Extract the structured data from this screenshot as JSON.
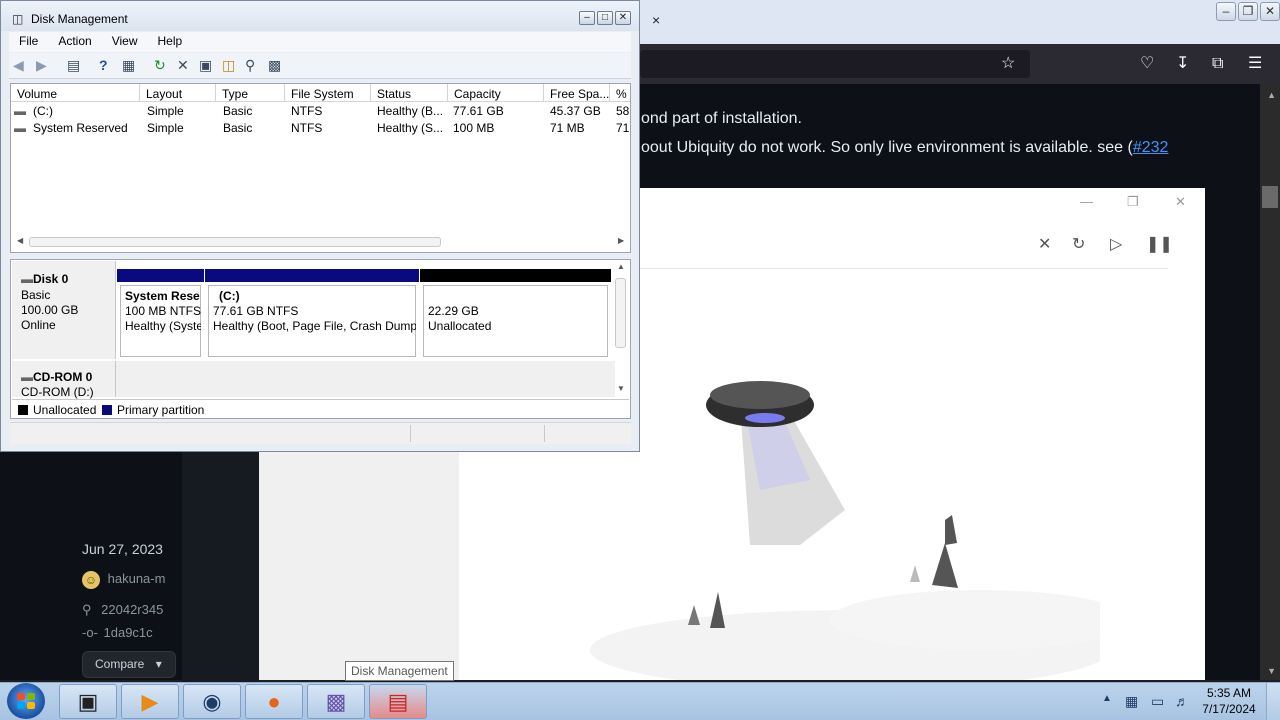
{
  "browser": {
    "text_line1": "ond part of installation.",
    "text_line2": "oout Ubiquity do not work. So only live environment is available. see (",
    "link": "#232",
    "date": "Jun 27, 2023",
    "author": "hakuna-m",
    "tag": "22042r345",
    "commit": "1da9c1c",
    "compare_label": "Compare",
    "close_glyph": "×"
  },
  "disk_management": {
    "title": "Disk Management",
    "menu": [
      "File",
      "Action",
      "View",
      "Help"
    ],
    "columns": [
      "Volume",
      "Layout",
      "Type",
      "File System",
      "Status",
      "Capacity",
      "Free Spa...",
      "%"
    ],
    "volumes": [
      {
        "volume": "(C:)",
        "layout": "Simple",
        "type": "Basic",
        "fs": "NTFS",
        "status": "Healthy (B...",
        "capacity": "77.61 GB",
        "free": "45.37 GB",
        "pct": "58"
      },
      {
        "volume": "System Reserved",
        "layout": "Simple",
        "type": "Basic",
        "fs": "NTFS",
        "status": "Healthy (S...",
        "capacity": "100 MB",
        "free": "71 MB",
        "pct": "71"
      }
    ],
    "disk0": {
      "name": "Disk 0",
      "type": "Basic",
      "size": "100.00 GB",
      "state": "Online",
      "partitions": [
        {
          "name": "System Rese",
          "size": "100 MB NTFS",
          "status": "Healthy (Syste"
        },
        {
          "name": "(C:)",
          "size": "77.61 GB NTFS",
          "status": "Healthy (Boot, Page File, Crash Dump,"
        },
        {
          "name": "",
          "size": "22.29 GB",
          "status": "Unallocated"
        }
      ]
    },
    "cdrom": {
      "name": "CD-ROM 0",
      "drive": "CD-ROM (D:)"
    },
    "legend": {
      "unallocated": "Unallocated",
      "primary": "Primary partition"
    },
    "colors": {
      "primary": "#0a0a80",
      "unallocated": "#000000"
    }
  },
  "tooltip": "Disk Management",
  "taskbar": {
    "time": "5:35 AM",
    "date": "7/17/2024",
    "apps": [
      "terminal-icon",
      "media-player-icon",
      "globe-icon",
      "firefox-icon",
      "window-app-icon",
      "toolbox-icon"
    ]
  }
}
